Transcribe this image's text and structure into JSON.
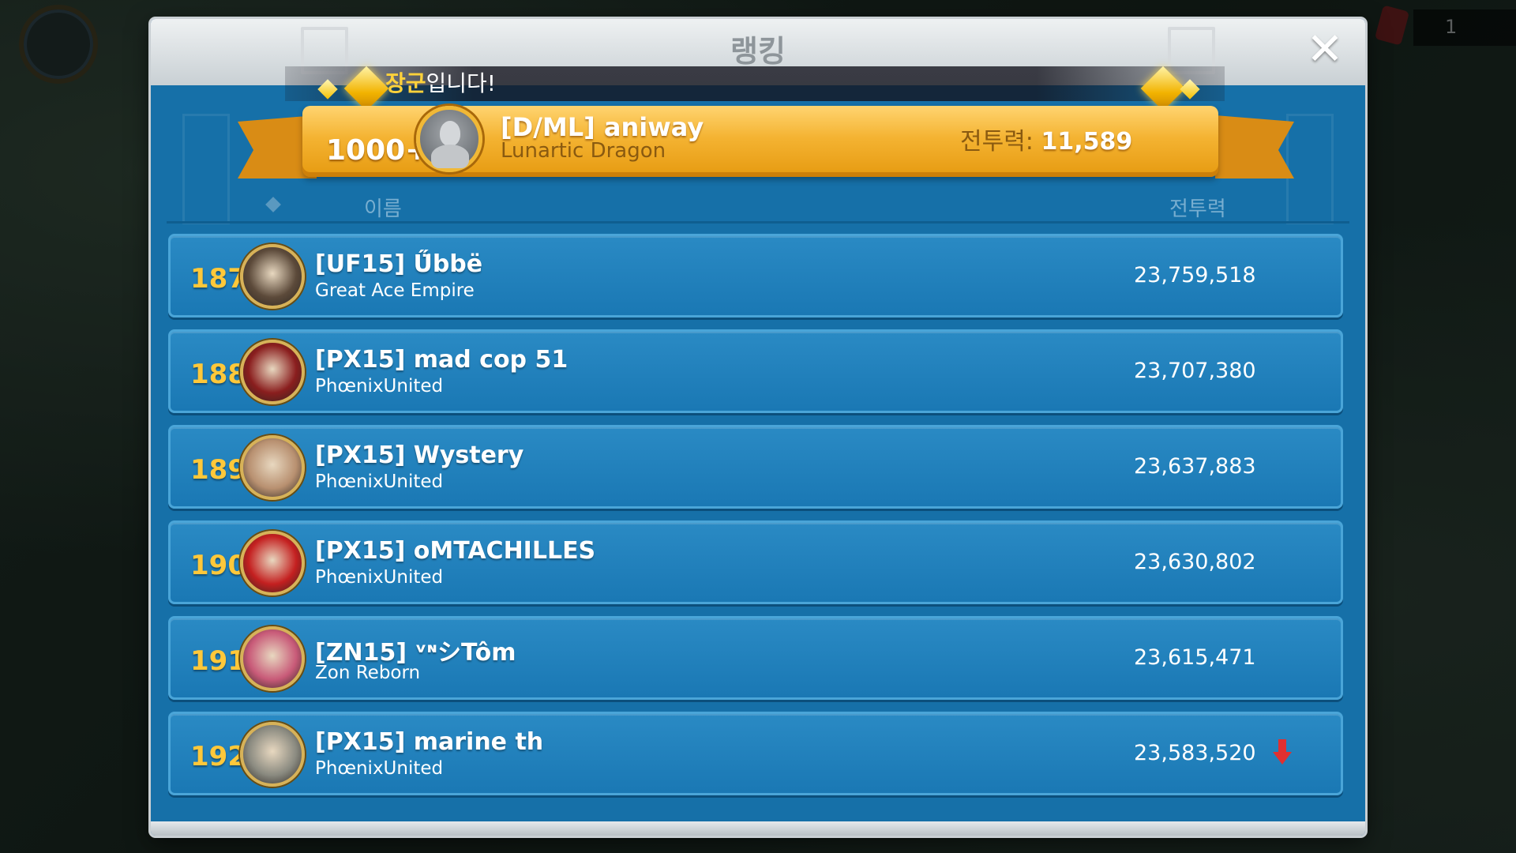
{
  "panel": {
    "title": "랭킹",
    "close_label": "✕",
    "banner_highlight": "장군",
    "banner_rest": "입니다!"
  },
  "my_entry": {
    "rank": "1000+",
    "name": "[D/ML] aniway",
    "alliance": "Lunartic Dragon",
    "power_label": "전투력: ",
    "power_value": "11,589"
  },
  "columns": {
    "name": "이름",
    "power": "전투력"
  },
  "rows": [
    {
      "rank": "187",
      "name": "[UF15] Ű̈bbë",
      "alliance": "Great Ace Empire",
      "power": "23,759,518",
      "avatar_color": "#5c4a3a"
    },
    {
      "rank": "188",
      "name": "[PX15] mad cop 51",
      "alliance": "PhœnixUnited",
      "power": "23,707,380",
      "avatar_color": "#8a1e1e"
    },
    {
      "rank": "189",
      "name": "[PX15] Wystery",
      "alliance": "PhœnixUnited",
      "power": "23,637,883",
      "avatar_color": "#b89070"
    },
    {
      "rank": "190",
      "name": "[PX15] oMTACHILLES",
      "alliance": "PhœnixUnited",
      "power": "23,630,802",
      "avatar_color": "#c42020"
    },
    {
      "rank": "191",
      "name": "[ZN15] ᵛᶰシTôm",
      "alliance": "Zon Reborn",
      "power": "23,615,471",
      "avatar_color": "#c85a78"
    },
    {
      "rank": "192",
      "name": "[PX15] marine th",
      "alliance": "PhœnixUnited",
      "power": "23,583,520",
      "avatar_color": "#8a8a80",
      "trend": "down"
    }
  ],
  "colors": {
    "panel_blue": "#1670a8",
    "row_blue": "#2a8ac4",
    "rank_gold": "#ffc83a",
    "ribbon_gold": "#f4b332",
    "down_arrow": "#e03030"
  }
}
